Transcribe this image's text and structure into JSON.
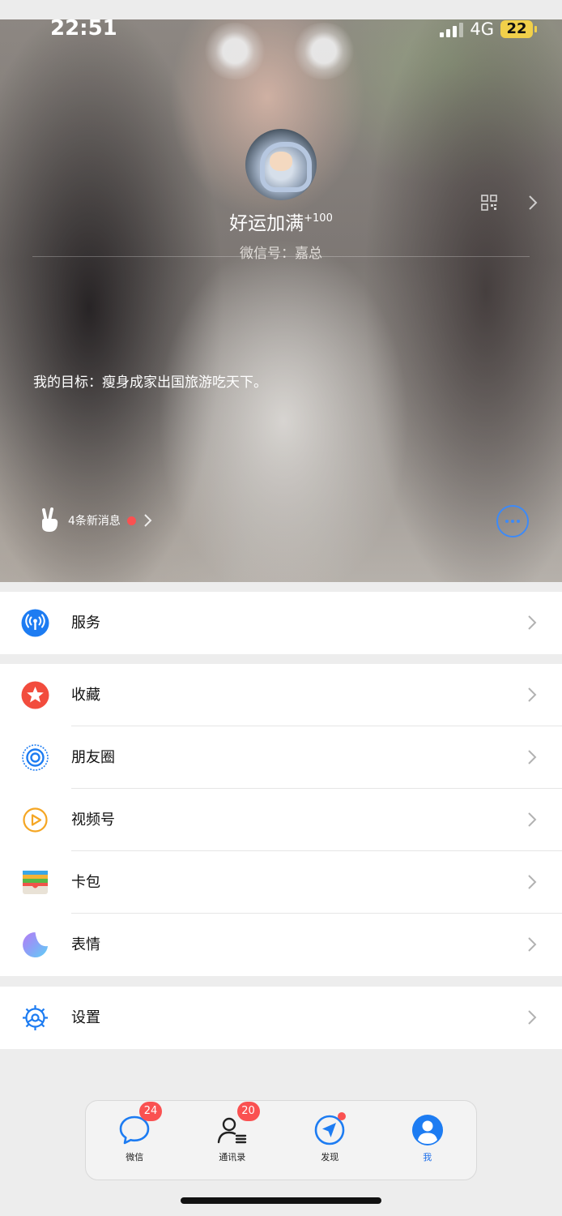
{
  "status_bar": {
    "time": "22:51",
    "network": "4G",
    "battery": "22"
  },
  "profile": {
    "nickname": "好运加满",
    "nickname_sup": "+100",
    "wechat_id": "微信号：嘉总",
    "status_text": "我的目标：瘦身成家出国旅游吃天下。",
    "new_messages": "4条新消息"
  },
  "menu": {
    "services": "服务",
    "favorites": "收藏",
    "moments": "朋友圈",
    "channels": "视频号",
    "cards": "卡包",
    "stickers": "表情",
    "settings": "设置"
  },
  "tabbar": {
    "tabs": [
      {
        "label": "微信",
        "badge": "24"
      },
      {
        "label": "通讯录",
        "badge": "20"
      },
      {
        "label": "发现"
      },
      {
        "label": "我"
      }
    ]
  },
  "colors": {
    "accent": "#1e6fea",
    "badge": "#fa5151",
    "favorites": "#f24c3d",
    "channels": "#f5a623"
  },
  "icons": [
    "signal-icon",
    "battery-icon",
    "qr-code-icon",
    "chevron-right-icon",
    "peace-hand-icon",
    "more-icon",
    "service-icon",
    "star-icon",
    "moments-icon",
    "channels-icon",
    "wallet-icon",
    "sticker-icon",
    "settings-icon",
    "chat-icon",
    "contacts-icon",
    "discover-icon",
    "me-icon"
  ]
}
